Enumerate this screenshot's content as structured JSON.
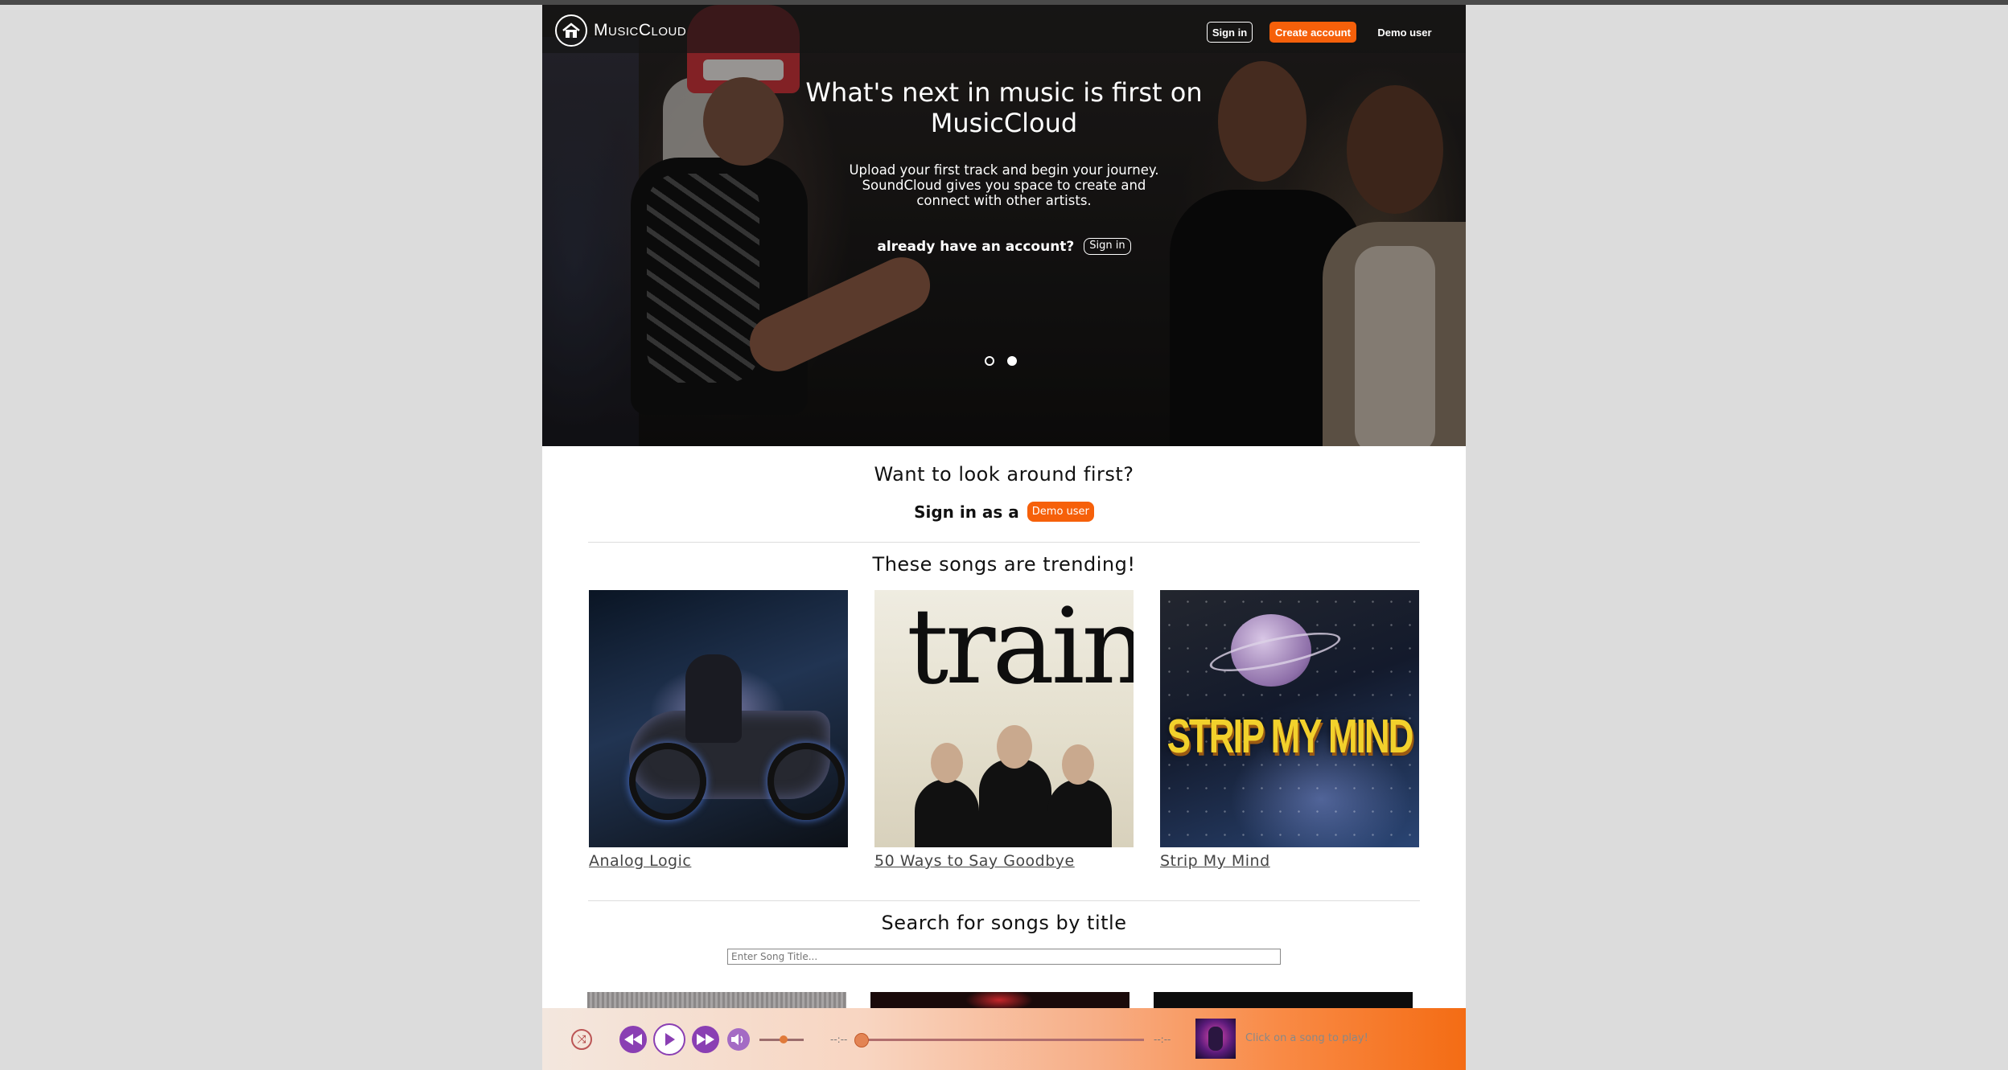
{
  "brand": {
    "name": "MusicCloud"
  },
  "nav": {
    "signin": "Sign in",
    "create": "Create account",
    "demo": "Demo user"
  },
  "hero": {
    "title": "What's next in music is first on MusicCloud",
    "subtitle": "Upload your first track and begin your journey. SoundCloud gives you space to create and connect with other artists.",
    "account_prompt": "already have an account?",
    "signin": "Sign in",
    "slides": 2,
    "active_slide": 2
  },
  "lookaround": {
    "title": "Want to look around first?",
    "prefix": "Sign in as a",
    "demo_button": "Demo user"
  },
  "trending": {
    "title": "These songs are trending!",
    "songs": [
      {
        "title": "Analog Logic"
      },
      {
        "title": "50 Ways to Say Goodbye"
      },
      {
        "title": "Strip My Mind"
      }
    ],
    "cover_text": {
      "train": "train",
      "strip": "STRIP MY MIND"
    }
  },
  "search": {
    "title": "Search for songs by title",
    "placeholder": "Enter Song Title..."
  },
  "player": {
    "time_elapsed": "--:--",
    "time_total": "--:--",
    "now_playing": "Click on a song to play!",
    "volume": 0.55,
    "progress": 0.0
  },
  "colors": {
    "accent": "#f6600a",
    "player_purple": "#8a3fb3"
  }
}
